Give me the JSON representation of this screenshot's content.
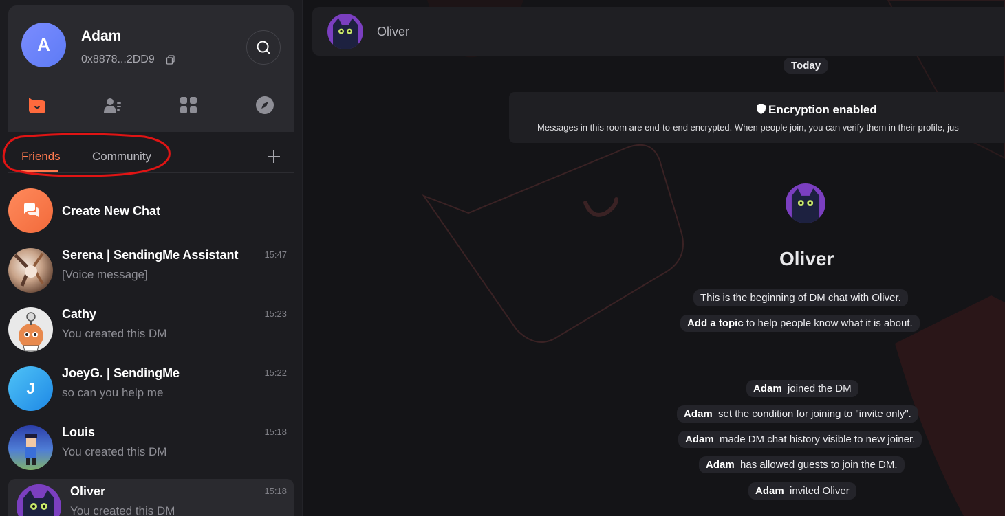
{
  "profile": {
    "avatar_letter": "A",
    "name": "Adam",
    "address": "0x8878...2DD9"
  },
  "tabs": {
    "friends": "Friends",
    "community": "Community"
  },
  "create_chat": {
    "label": "Create New Chat"
  },
  "chats": [
    {
      "name": "Serena | SendingMe Assistant",
      "preview": "[Voice message]",
      "time": "15:47"
    },
    {
      "name": "Cathy",
      "preview": "You created this DM",
      "time": "15:23"
    },
    {
      "name": "JoeyG. | SendingMe",
      "preview": "so can you help me",
      "time": "15:22",
      "avatar_letter": "J"
    },
    {
      "name": "Louis",
      "preview": "You created this DM",
      "time": "15:18"
    },
    {
      "name": "Oliver",
      "preview": "You created this DM",
      "time": "15:18"
    }
  ],
  "room": {
    "title": "Oliver",
    "date_divider": "Today",
    "encryption_title": "Encryption enabled",
    "encryption_desc": "Messages in this room are end-to-end encrypted. When people join, you can verify them in their profile, jus",
    "peer_name": "Oliver",
    "intro": "This is the beginning of DM chat with Oliver.",
    "topic_action": "Add a topic",
    "topic_rest": " to help people know what it is about.",
    "events": [
      {
        "actor": "Adam",
        "text": "joined the DM"
      },
      {
        "actor": "Adam",
        "text": "set the condition for joining to \"invite only\"."
      },
      {
        "actor": "Adam",
        "text": "made DM chat history visible to new joiner."
      },
      {
        "actor": "Adam",
        "text": "has allowed guests to join the DM."
      },
      {
        "actor": "Adam",
        "text": "invited Oliver"
      }
    ]
  },
  "colors": {
    "accent": "#ff7a4f",
    "annotation_red": "#e01414"
  }
}
